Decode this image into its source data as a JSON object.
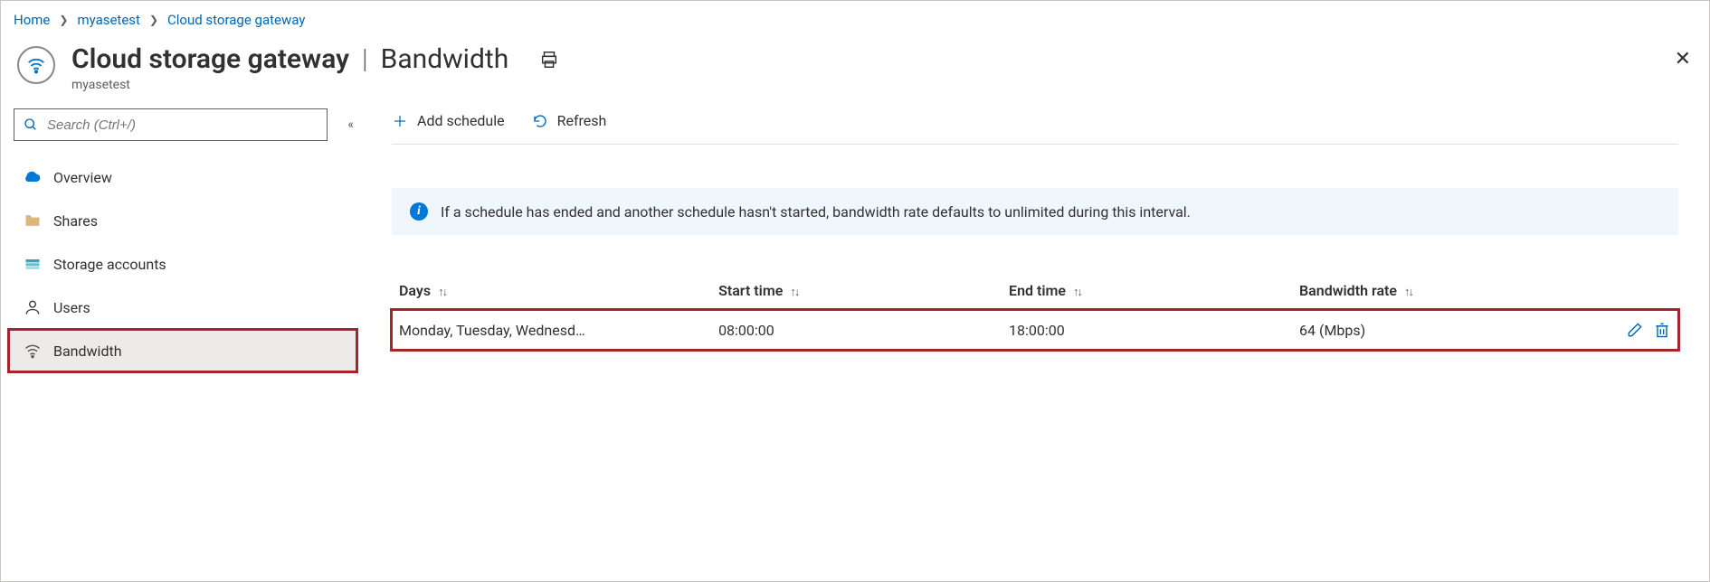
{
  "breadcrumb": {
    "items": [
      {
        "label": "Home"
      },
      {
        "label": "myasetest"
      },
      {
        "label": "Cloud storage gateway"
      }
    ]
  },
  "header": {
    "resource_name": "Cloud storage gateway",
    "blade_name": "Bandwidth",
    "subtitle": "myasetest"
  },
  "search": {
    "placeholder": "Search (Ctrl+/)"
  },
  "sidebar": {
    "items": [
      {
        "icon": "cloud-icon",
        "label": "Overview"
      },
      {
        "icon": "folder-icon",
        "label": "Shares"
      },
      {
        "icon": "storage-icon",
        "label": "Storage accounts"
      },
      {
        "icon": "user-icon",
        "label": "Users"
      },
      {
        "icon": "wifi-icon",
        "label": "Bandwidth",
        "selected": true,
        "highlight": true
      }
    ]
  },
  "commands": {
    "add": "Add schedule",
    "refresh": "Refresh"
  },
  "info_banner": "If a schedule has ended and another schedule hasn't started, bandwidth rate defaults to unlimited during this interval.",
  "table": {
    "columns": {
      "days": "Days",
      "start": "Start time",
      "end": "End time",
      "rate": "Bandwidth rate"
    },
    "rows": [
      {
        "days": "Monday, Tuesday, Wednesd…",
        "start": "08:00:00",
        "end": "18:00:00",
        "rate": "64 (Mbps)",
        "highlight": true
      }
    ]
  }
}
